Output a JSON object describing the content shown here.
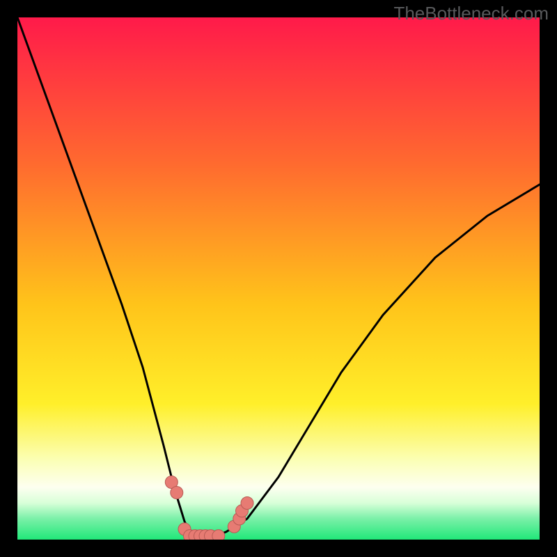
{
  "watermark": "TheBottleneck.com",
  "colors": {
    "bg_top": "#ff1a4a",
    "bg_mid1": "#ff7a2a",
    "bg_mid2": "#ffd21a",
    "bg_mid3": "#ffff55",
    "bg_low1": "#fdffe0",
    "bg_low2": "#d6ffd6",
    "bg_green": "#20e879",
    "curve": "#000000",
    "marker_fill": "#e77b73",
    "marker_stroke": "#b75a54"
  },
  "chart_data": {
    "type": "line",
    "title": "",
    "xlabel": "",
    "ylabel": "",
    "xlim": [
      0,
      100
    ],
    "ylim": [
      0,
      100
    ],
    "series": [
      {
        "name": "bottleneck-curve",
        "x": [
          0,
          4,
          8,
          12,
          16,
          20,
          24,
          28,
          30,
          32,
          33,
          34,
          36,
          38,
          40,
          44,
          50,
          56,
          62,
          70,
          80,
          90,
          100
        ],
        "y": [
          100,
          89,
          78,
          67,
          56,
          45,
          33,
          18,
          10,
          3.5,
          1.5,
          0.7,
          0.7,
          0.7,
          1.5,
          4,
          12,
          22,
          32,
          43,
          54,
          62,
          68
        ]
      }
    ],
    "markers": {
      "name": "highlight-points",
      "x": [
        29.5,
        30.5,
        32,
        33,
        34,
        35,
        36,
        37,
        38.5,
        41.5,
        42.5,
        43,
        44
      ],
      "y": [
        11,
        9,
        2,
        0.7,
        0.7,
        0.7,
        0.7,
        0.7,
        0.7,
        2.5,
        4,
        5.5,
        7
      ]
    }
  }
}
